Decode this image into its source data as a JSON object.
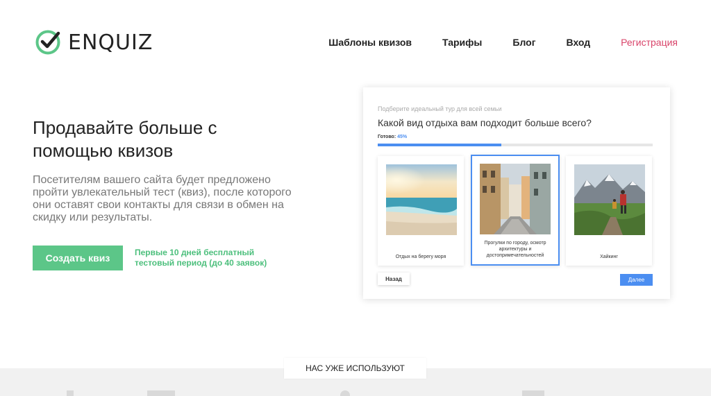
{
  "header": {
    "logo_text": "ENQUIZ",
    "nav": [
      "Шаблоны квизов",
      "Тарифы",
      "Блог",
      "Вход",
      "Регистрация"
    ]
  },
  "hero": {
    "title": "Продавайте больше с помощью квизов",
    "description": "Посетителям вашего сайта будет предложено пройти увлекательный тест (квиз), после которого они оставят свои контакты для связи в обмен на скидку или результаты.",
    "cta_label": "Создать квиз",
    "cta_note": "Первые 10 дней бесплатный тестовый период (до 40 заявок)"
  },
  "quiz": {
    "subtitle": "Подберите идеальный тур для всей семьи",
    "question": "Какой вид отдыха вам подходит больше всего?",
    "ready_label": "Готово:",
    "progress_text": "45%",
    "progress_value": 0.45,
    "options": [
      {
        "label": "Отдых на берегу моря",
        "image": "beach-image"
      },
      {
        "label": "Прогулки по городу, осмотр архитектуры и достопримечательностей",
        "image": "old-town-street-image"
      },
      {
        "label": "Хайкинг",
        "image": "mountain-hiking-image"
      }
    ],
    "selected_index": 1,
    "back_label": "Назад",
    "next_label": "Далее"
  },
  "clients": {
    "badge": "НАС УЖЕ ИСПОЛЬЗУЮТ"
  },
  "colors": {
    "brand_green": "#5cc688",
    "accent_pink": "#d9446a",
    "quiz_blue": "#4b8ef1"
  }
}
